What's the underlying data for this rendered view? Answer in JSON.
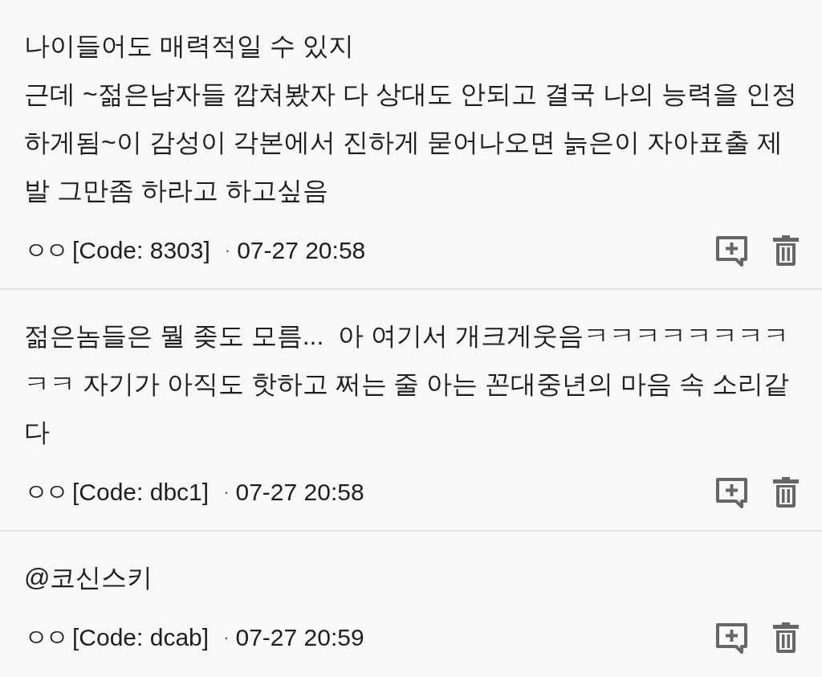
{
  "comments": [
    {
      "paragraphs": [
        "나이들어도 매력적일 수 있지",
        "근데 ~젊은남자들 깝쳐봤자 다 상대도 안되고 결국 나의 능력을 인정하게됨~이 감성이 각본에서 진하게 묻어나오면 늙은이 자아표출 제발 그만좀 하라고 하고싶음"
      ],
      "author": "ㅇㅇ",
      "code": "[Code: 8303]",
      "separator": "·",
      "time": "07-27 20:58"
    },
    {
      "paragraphs": [
        "젊은놈들은 뭘 좆도 모름...  아 여기서 개크게웃음ㅋㅋㅋㅋㅋㅋㅋㅋㅋㅋ 자기가 아직도 핫하고 쩌는 줄 아는 꼰대중년의 마음 속 소리같다"
      ],
      "author": "ㅇㅇ",
      "code": "[Code: dbc1]",
      "separator": "·",
      "time": "07-27 20:58"
    },
    {
      "paragraphs": [
        "@코신스키"
      ],
      "author": "ㅇㅇ",
      "code": "[Code: dcab]",
      "separator": "·",
      "time": "07-27 20:59"
    }
  ]
}
